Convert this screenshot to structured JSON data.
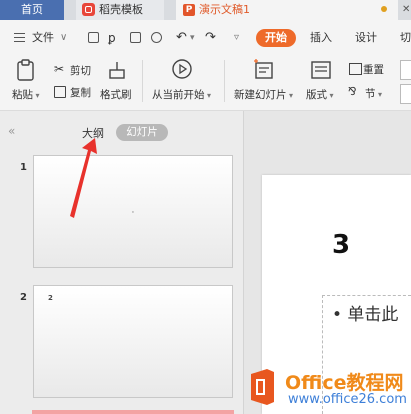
{
  "tabs": {
    "home": "首页",
    "template": "稻壳模板",
    "document": "演示文稿1"
  },
  "menu": {
    "file": "文件",
    "start": "开始",
    "insert": "插入",
    "design": "设计",
    "cut_off": "切"
  },
  "ribbon": {
    "paste": "粘贴",
    "cut": "剪切",
    "copy": "复制",
    "format_painter": "格式刷",
    "from_current": "从当前开始",
    "new_slide": "新建幻灯片",
    "layout": "版式",
    "reset": "重置",
    "section": "节"
  },
  "left_panel": {
    "outline_tab": "大纲",
    "slides_tab": "幻灯片",
    "slides": [
      {
        "number": "1",
        "mark": "'"
      },
      {
        "number": "2",
        "mark": "2"
      }
    ]
  },
  "canvas": {
    "title": "3",
    "bullet": "• 单击此"
  },
  "watermark": {
    "line1": "Office教程网",
    "line2": "www.office26.com"
  },
  "colors": {
    "accent": "#ee6a2a",
    "tab_home": "#4a6fb0",
    "arrow": "#e8322c"
  }
}
